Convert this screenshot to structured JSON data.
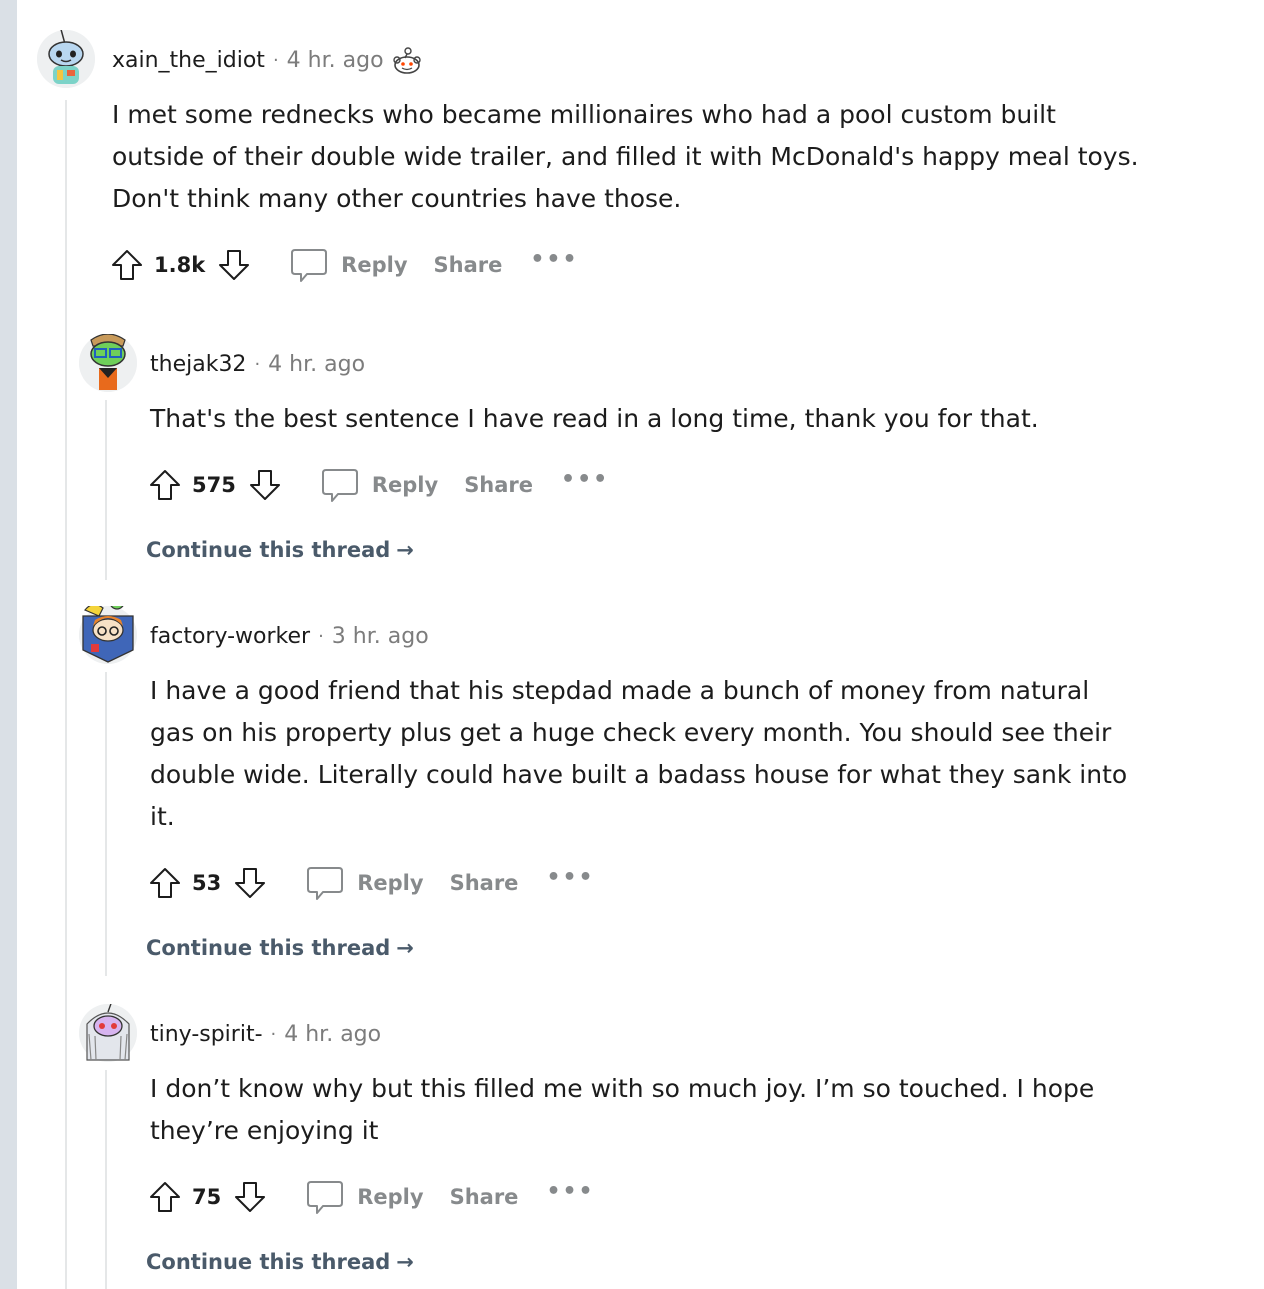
{
  "comments": [
    {
      "username": "xain_the_idiot",
      "separator": "·",
      "time": "4 hr. ago",
      "award": "snoo-award-icon",
      "lines": [
        "I met some rednecks who became millionaires who had a pool custom built",
        "outside of their double wide trailer, and filled it with McDonald's happy meal toys.",
        "Don't think many other countries have those."
      ],
      "score": "1.8k",
      "reply_label": "Reply",
      "share_label": "Share",
      "more_label": "•••"
    },
    {
      "username": "thejak32",
      "separator": "·",
      "time": "4 hr. ago",
      "lines": [
        "That's the best sentence I have read in a long time, thank you for that."
      ],
      "score": "575",
      "reply_label": "Reply",
      "share_label": "Share",
      "more_label": "•••",
      "continue_label": "Continue this thread"
    },
    {
      "username": "factory-worker",
      "separator": "·",
      "time": "3 hr. ago",
      "lines": [
        "I have a good friend that his stepdad made a bunch of money from natural",
        "gas on his property plus get a huge check every month. You should see their",
        "double wide. Literally could have built a badass house for what they sank into",
        "it."
      ],
      "score": "53",
      "reply_label": "Reply",
      "share_label": "Share",
      "more_label": "•••",
      "continue_label": "Continue this thread"
    },
    {
      "username": "tiny-spirit-",
      "separator": "·",
      "time": "4 hr. ago",
      "lines": [
        "I don’t know why but this filled me with so much joy. I’m so touched. I hope",
        "they’re enjoying it"
      ],
      "score": "75",
      "reply_label": "Reply",
      "share_label": "Share",
      "more_label": "•••",
      "continue_label": "Continue this thread"
    }
  ],
  "colors": {
    "page_bg": "#ffffff",
    "side_strip": "#dae0e6",
    "thread_line": "#e5e7e8",
    "muted_text": "#7c7c7c",
    "action_text": "#878a8c",
    "continue_text": "#4a5a6a"
  }
}
